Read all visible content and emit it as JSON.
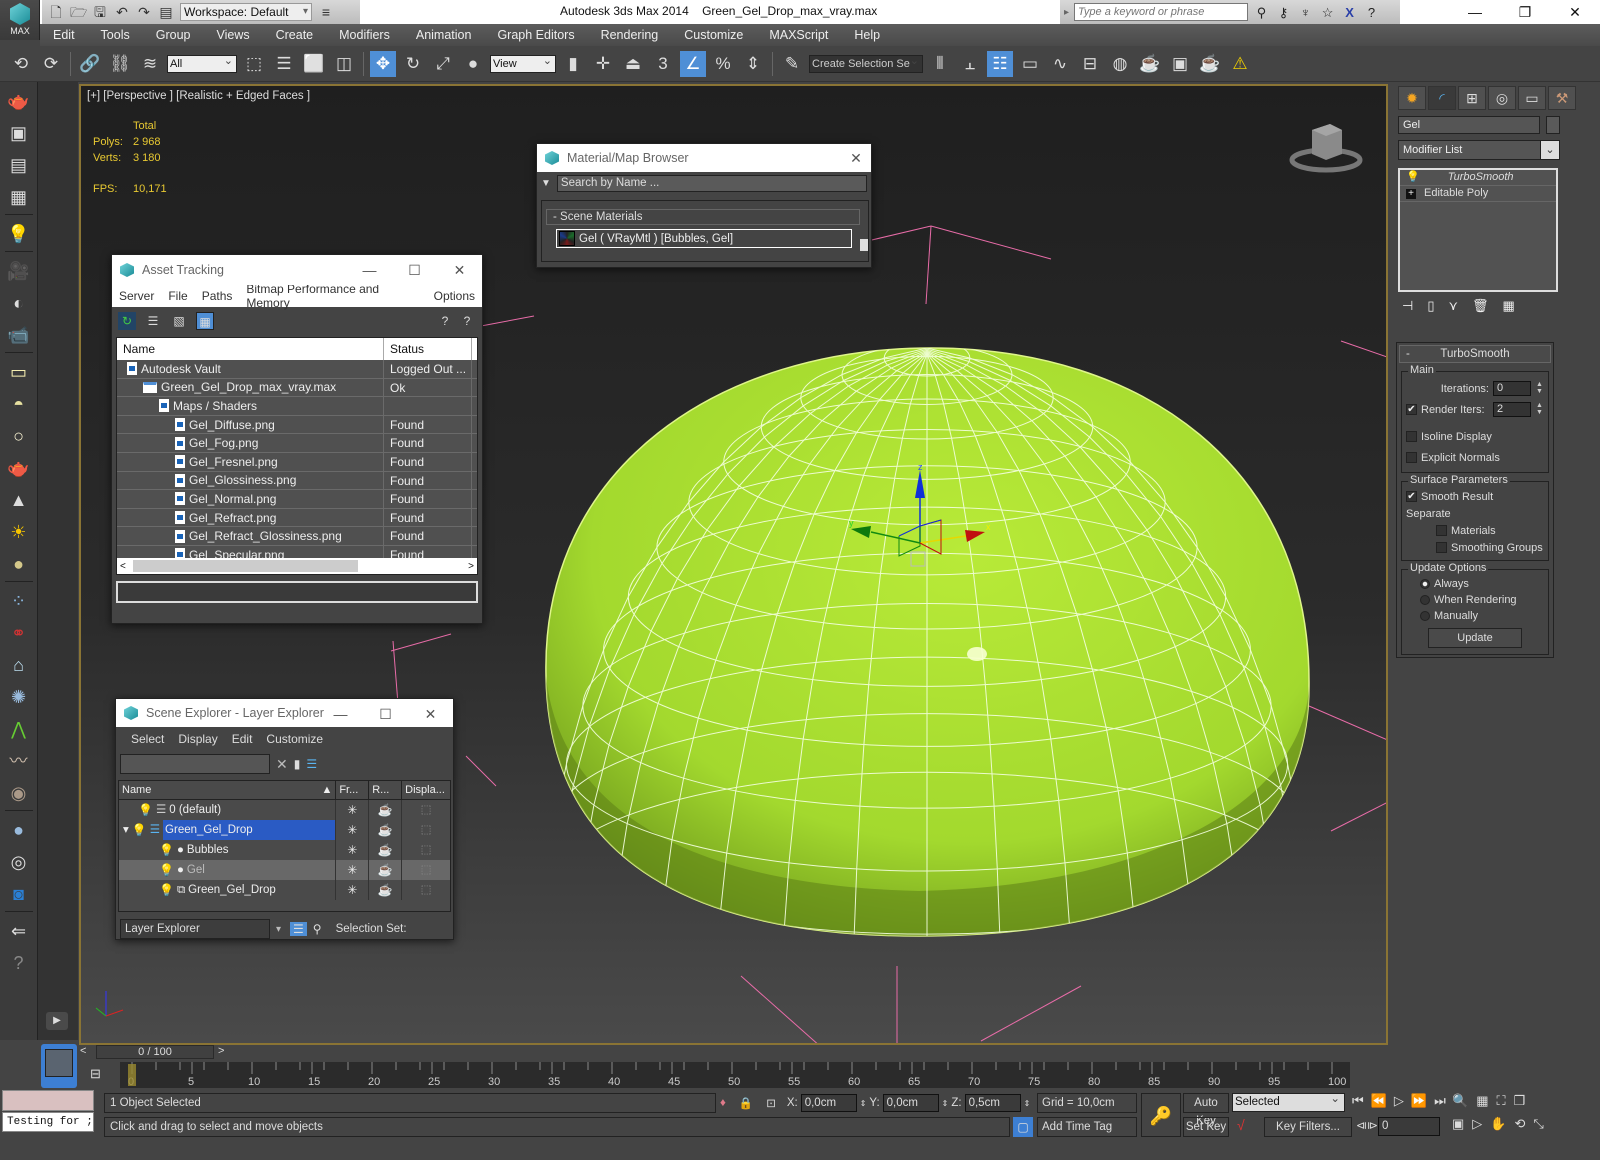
{
  "titlebar": {
    "logo_label": "MAX",
    "workspace": "Workspace: Default",
    "app_title": "Autodesk 3ds Max  2014",
    "file_name": "Green_Gel_Drop_max_vray.max",
    "search_placeholder": "Type a keyword or phrase"
  },
  "menubar": [
    "Edit",
    "Tools",
    "Group",
    "Views",
    "Create",
    "Modifiers",
    "Animation",
    "Graph Editors",
    "Rendering",
    "Customize",
    "MAXScript",
    "Help"
  ],
  "toolbar": {
    "selection_filter": "All",
    "ref_coord": "View",
    "named_selection_placeholder": "Create Selection Se",
    "snap_label": "3"
  },
  "viewport": {
    "label": "[+] [Perspective ] [Realistic + Edged Faces ]",
    "stats": {
      "header": "Total",
      "polys_label": "Polys:",
      "polys": "2 968",
      "verts_label": "Verts:",
      "verts": "3 180",
      "fps_label": "FPS:",
      "fps": "10,171"
    },
    "object_color": "#a3d92e",
    "gizmo_axes": [
      "x",
      "y",
      "z"
    ]
  },
  "asset_tracking": {
    "title": "Asset Tracking",
    "menu": [
      "Server",
      "File",
      "Paths",
      "Bitmap Performance and Memory",
      "Options"
    ],
    "columns": [
      "Name",
      "Status"
    ],
    "rows": [
      {
        "name": "Autodesk Vault",
        "status": "Logged Out ...",
        "level": 1,
        "icon": "file"
      },
      {
        "name": "Green_Gel_Drop_max_vray.max",
        "status": "Ok",
        "level": 2,
        "icon": "max"
      },
      {
        "name": "Maps / Shaders",
        "status": "",
        "level": 3,
        "icon": "file"
      },
      {
        "name": "Gel_Diffuse.png",
        "status": "Found",
        "level": 4,
        "icon": "file"
      },
      {
        "name": "Gel_Fog.png",
        "status": "Found",
        "level": 4,
        "icon": "file"
      },
      {
        "name": "Gel_Fresnel.png",
        "status": "Found",
        "level": 4,
        "icon": "file"
      },
      {
        "name": "Gel_Glossiness.png",
        "status": "Found",
        "level": 4,
        "icon": "file"
      },
      {
        "name": "Gel_Normal.png",
        "status": "Found",
        "level": 4,
        "icon": "file"
      },
      {
        "name": "Gel_Refract.png",
        "status": "Found",
        "level": 4,
        "icon": "file"
      },
      {
        "name": "Gel_Refract_Glossiness.png",
        "status": "Found",
        "level": 4,
        "icon": "file"
      },
      {
        "name": "Gel_Specular.png",
        "status": "Found",
        "level": 4,
        "icon": "file"
      }
    ]
  },
  "material_browser": {
    "title": "Material/Map Browser",
    "search_placeholder": "Search by Name ...",
    "group": "- Scene Materials",
    "item": "Gel  ( VRayMtl ) [Bubbles, Gel]"
  },
  "scene_explorer": {
    "title": "Scene Explorer - Layer Explorer",
    "menu": [
      "Select",
      "Display",
      "Edit",
      "Customize"
    ],
    "columns": [
      "Name",
      "Fr...",
      "R...",
      "Displa..."
    ],
    "rows": [
      {
        "name": "0 (default)",
        "type": "layer",
        "selected": false,
        "highlight": false,
        "indent": 1
      },
      {
        "name": "Green_Gel_Drop",
        "type": "layer",
        "selected": true,
        "highlight": false,
        "indent": 1,
        "expanded": true
      },
      {
        "name": "Bubbles",
        "type": "object",
        "selected": false,
        "highlight": false,
        "indent": 2
      },
      {
        "name": "Gel",
        "type": "object",
        "selected": false,
        "highlight": true,
        "indent": 2
      },
      {
        "name": "Green_Gel_Drop",
        "type": "group",
        "selected": false,
        "highlight": false,
        "indent": 2
      }
    ],
    "footer_mode": "Layer Explorer",
    "selection_set_label": "Selection Set:"
  },
  "command_panel": {
    "object_name": "Gel",
    "modifier_list": "Modifier List",
    "stack": [
      "TurboSmooth",
      "Editable Poly"
    ],
    "rollout_title": "TurboSmooth",
    "main_group": "Main",
    "iterations_label": "Iterations:",
    "iterations": "0",
    "render_iters_label": "Render Iters:",
    "render_iters": "2",
    "render_iters_checked": true,
    "isoline_label": "Isoline Display",
    "isoline_checked": false,
    "explicit_normals_label": "Explicit Normals",
    "explicit_normals_checked": false,
    "surface_group": "Surface Parameters",
    "smooth_result_label": "Smooth Result",
    "smooth_result_checked": true,
    "separate_label": "Separate",
    "materials_label": "Materials",
    "materials_checked": false,
    "smoothing_groups_label": "Smoothing Groups",
    "smoothing_groups_checked": false,
    "update_group": "Update Options",
    "update_options": [
      "Always",
      "When Rendering",
      "Manually"
    ],
    "update_selected": "Always",
    "update_button": "Update"
  },
  "timeline": {
    "slider_label": "0 / 100",
    "current_frame": 0,
    "total_frames": 100,
    "ticks": [
      "0",
      "5",
      "10",
      "15",
      "20",
      "25",
      "30",
      "35",
      "40",
      "45",
      "50",
      "55",
      "60",
      "65",
      "70",
      "75",
      "80",
      "85",
      "90",
      "95",
      "100"
    ]
  },
  "status": {
    "maxscript_output": "Testing for ;",
    "selection_info": "1 Object Selected",
    "prompt": "Click and drag to select and move objects",
    "x_label": "X:",
    "x": "0,0cm",
    "y_label": "Y:",
    "y": "0,0cm",
    "z_label": "Z:",
    "z": "0,5cm",
    "grid": "Grid = 10,0cm",
    "add_time_tag": "Add Time Tag",
    "auto_key": "Auto Key",
    "set_key": "Set Key",
    "key_mode": "Selected",
    "key_filters": "Key Filters...",
    "frame": "0"
  }
}
